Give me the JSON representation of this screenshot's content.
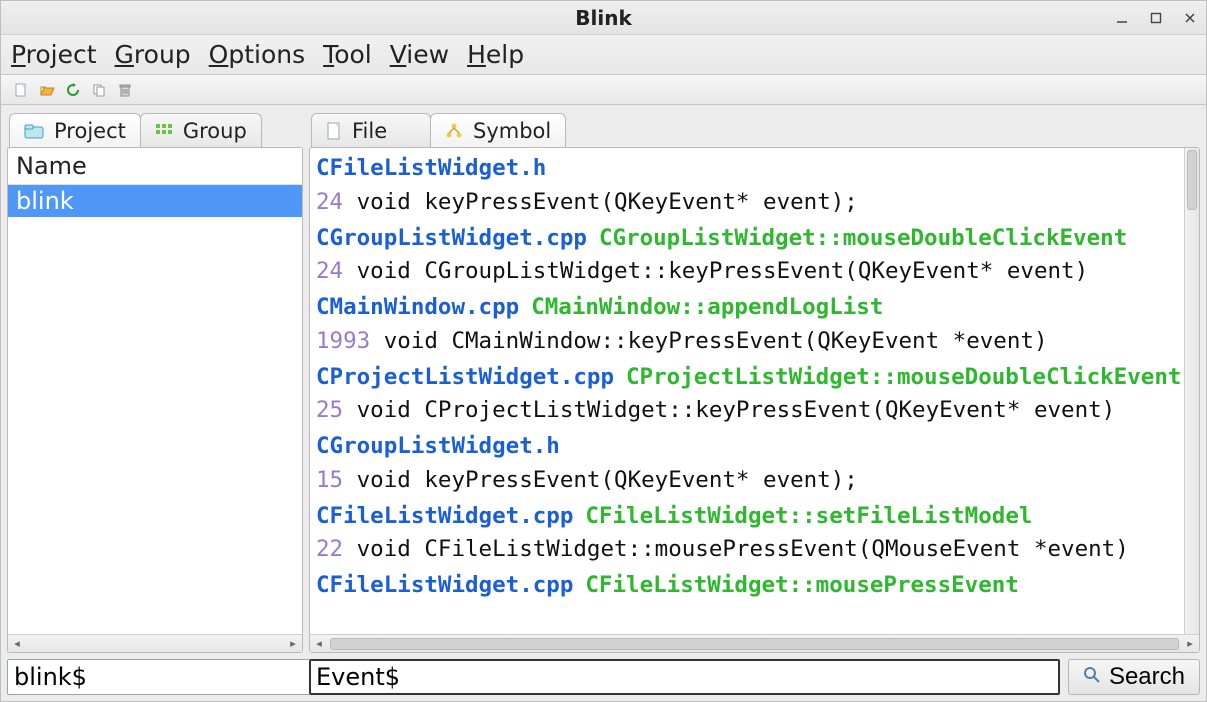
{
  "window": {
    "title": "Blink"
  },
  "menu": {
    "items": [
      {
        "label": "Project",
        "accel_index": 0
      },
      {
        "label": "Group",
        "accel_index": 0
      },
      {
        "label": "Options",
        "accel_index": 0
      },
      {
        "label": "Tool",
        "accel_index": 0
      },
      {
        "label": "View",
        "accel_index": 0
      },
      {
        "label": "Help",
        "accel_index": 0
      }
    ]
  },
  "toolbar": {
    "buttons": [
      "new-file-icon",
      "open-icon",
      "reload-icon",
      "copy-icon",
      "trash-icon"
    ]
  },
  "left_panel": {
    "tabs": [
      {
        "label": "Project",
        "icon": "project-icon",
        "active": true
      },
      {
        "label": "Group",
        "icon": "group-grid-icon",
        "active": false
      }
    ],
    "tree_header": "Name",
    "tree_items": [
      "blink"
    ],
    "selected_index": 0,
    "search_value": "blink$"
  },
  "right_panel": {
    "tabs": [
      {
        "label": "File",
        "icon": "file-icon",
        "active": false
      },
      {
        "label": "Symbol",
        "icon": "symbol-icon",
        "active": true
      }
    ],
    "search_value": "Event$",
    "search_button": "Search",
    "results": [
      {
        "file": "CFileListWidget.h",
        "func": "",
        "lineno": "24",
        "code": "void keyPressEvent(QKeyEvent* event);"
      },
      {
        "file": "CGroupListWidget.cpp",
        "func": "CGroupListWidget::mouseDoubleClickEvent",
        "lineno": "24",
        "code": "void CGroupListWidget::keyPressEvent(QKeyEvent* event)"
      },
      {
        "file": "CMainWindow.cpp",
        "func": "CMainWindow::appendLogList",
        "lineno": "1993",
        "code": "void CMainWindow::keyPressEvent(QKeyEvent *event)"
      },
      {
        "file": "CProjectListWidget.cpp",
        "func": "CProjectListWidget::mouseDoubleClickEvent",
        "lineno": "25",
        "code": "void CProjectListWidget::keyPressEvent(QKeyEvent* event)"
      },
      {
        "file": "CGroupListWidget.h",
        "func": "",
        "lineno": "15",
        "code": "void keyPressEvent(QKeyEvent* event);"
      },
      {
        "file": "CFileListWidget.cpp",
        "func": "CFileListWidget::setFileListModel",
        "lineno": "22",
        "code": "void CFileListWidget::mousePressEvent(QMouseEvent *event)"
      },
      {
        "file": "CFileListWidget.cpp",
        "func": "CFileListWidget::mousePressEvent",
        "lineno": "",
        "code": ""
      }
    ]
  },
  "colors": {
    "selection": "#4f98f7",
    "file_link": "#1a5fd6",
    "func": "#2fb72f",
    "lineno": "#9a7bc9"
  }
}
